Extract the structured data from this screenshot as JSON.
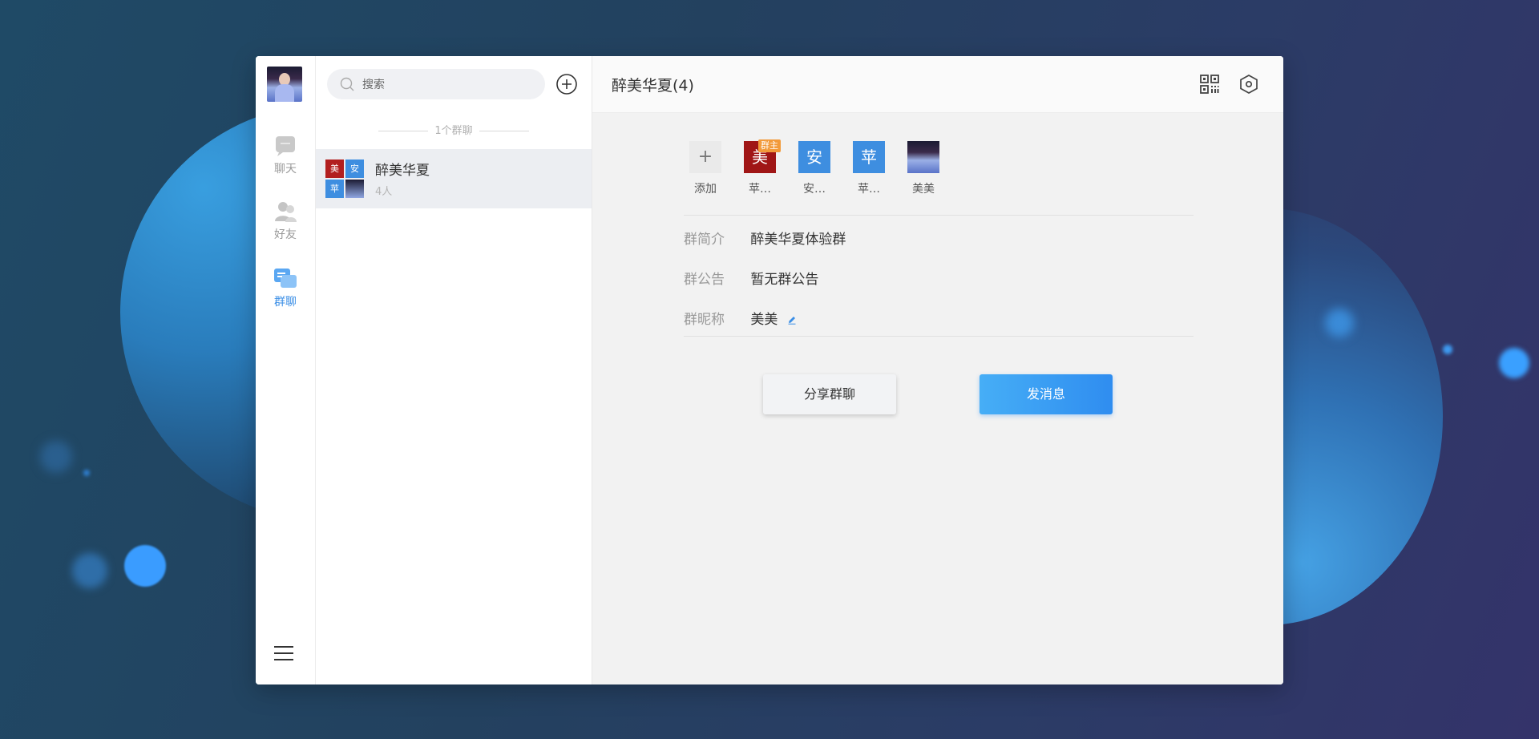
{
  "rail": {
    "nav": [
      {
        "label": "聊天",
        "icon": "chat-bubble-icon",
        "active": false
      },
      {
        "label": "好友",
        "icon": "friends-icon",
        "active": false
      },
      {
        "label": "群聊",
        "icon": "group-chat-icon",
        "active": true
      }
    ],
    "menu_icon": "hamburger-menu-icon",
    "accent": "#3a8ee6"
  },
  "list": {
    "search_placeholder": "搜索",
    "section_label": "1个群聊",
    "groups": [
      {
        "name": "醉美华夏",
        "count": "4人",
        "avatar_cells": [
          "美",
          "安",
          "苹",
          ""
        ]
      }
    ]
  },
  "main": {
    "title": "醉美华夏(4)",
    "header_icons": [
      "qr-code-icon",
      "settings-hexagon-icon"
    ],
    "members": [
      {
        "label": "添加",
        "avatar": "+",
        "kind": "add"
      },
      {
        "label": "苹…",
        "avatar": "美",
        "kind": "red",
        "badge": "群主"
      },
      {
        "label": "安…",
        "avatar": "安",
        "kind": "blue"
      },
      {
        "label": "苹…",
        "avatar": "苹",
        "kind": "blue"
      },
      {
        "label": "美美",
        "avatar": "",
        "kind": "photo"
      }
    ],
    "info": [
      {
        "label": "群简介",
        "value": "醉美华夏体验群"
      },
      {
        "label": "群公告",
        "value": "暂无群公告"
      },
      {
        "label": "群昵称",
        "value": "美美"
      }
    ],
    "buttons": {
      "share": "分享群聊",
      "send": "发消息"
    }
  }
}
